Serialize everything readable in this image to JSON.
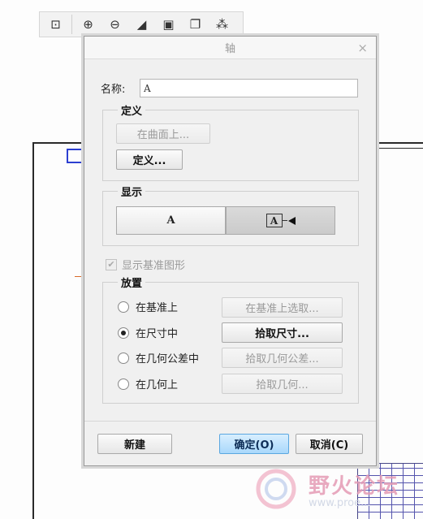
{
  "background": {
    "toolbar": {
      "icons": [
        "zoom-fit-icon",
        "zoom-in-icon",
        "zoom-out-icon",
        "refit-icon",
        "box-view-icon",
        "layer-icon",
        "datum-display-icon"
      ]
    },
    "watermark": {
      "text": "野火论坛",
      "url": "www.proe..."
    }
  },
  "dialog": {
    "title": "轴",
    "close_glyph": "×",
    "name_label": "名称:",
    "name_value": "A",
    "definition": {
      "title": "定义",
      "on_surface_button": "在曲面上...",
      "define_button": "定义..."
    },
    "display": {
      "title": "显示",
      "option_a": "A",
      "option_axis_label": "A"
    },
    "show_datum_checkbox": "显示基准图形",
    "placement": {
      "title": "放置",
      "options": [
        {
          "label": "在基准上",
          "button": "在基准上选取...",
          "selected": false,
          "enabled": false
        },
        {
          "label": "在尺寸中",
          "button": "拾取尺寸...",
          "selected": true,
          "enabled": true
        },
        {
          "label": "在几何公差中",
          "button": "拾取几何公差...",
          "selected": false,
          "enabled": false
        },
        {
          "label": "在几何上",
          "button": "拾取几何...",
          "selected": false,
          "enabled": false
        }
      ]
    },
    "footer": {
      "new_button": "新建",
      "ok_button": "确定(O)",
      "cancel_button": "取消(C)"
    }
  }
}
